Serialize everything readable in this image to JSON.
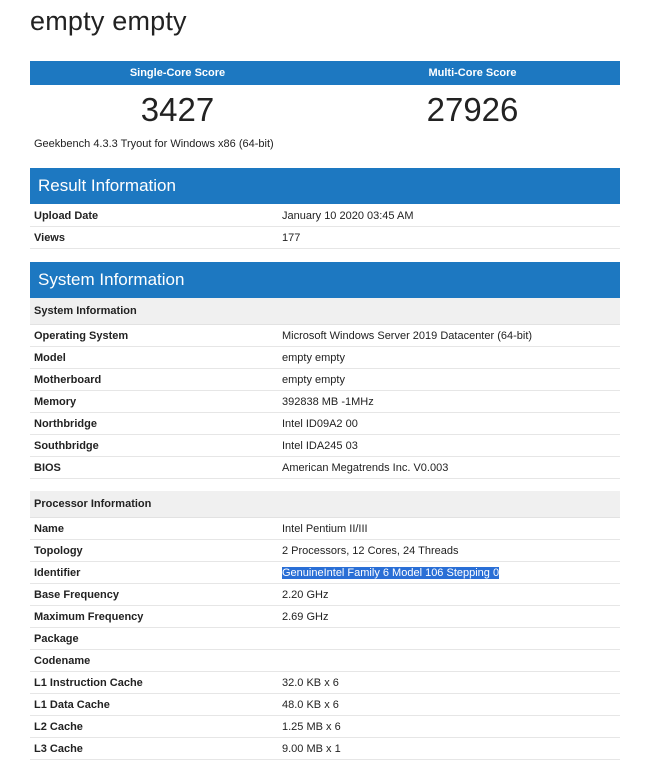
{
  "page": {
    "title": "empty empty"
  },
  "scores": {
    "single_label": "Single-Core Score",
    "multi_label": "Multi-Core Score",
    "single_value": "3427",
    "multi_value": "27926",
    "version": "Geekbench 4.3.3 Tryout for Windows x86 (64-bit)"
  },
  "result_info": {
    "title": "Result Information",
    "rows": [
      {
        "key": "Upload Date",
        "value": "January 10 2020 03:45 AM"
      },
      {
        "key": "Views",
        "value": "177"
      }
    ]
  },
  "system_info": {
    "title": "System Information",
    "system_sub": "System Information",
    "system_rows": [
      {
        "key": "Operating System",
        "value": "Microsoft Windows Server 2019 Datacenter (64-bit)"
      },
      {
        "key": "Model",
        "value": "empty empty"
      },
      {
        "key": "Motherboard",
        "value": "empty empty"
      },
      {
        "key": "Memory",
        "value": "392838 MB -1MHz"
      },
      {
        "key": "Northbridge",
        "value": "Intel ID09A2 00"
      },
      {
        "key": "Southbridge",
        "value": "Intel IDA245 03"
      },
      {
        "key": "BIOS",
        "value": "American Megatrends Inc. V0.003"
      }
    ],
    "processor_sub": "Processor Information",
    "processor_rows": [
      {
        "key": "Name",
        "value": "Intel Pentium II/III"
      },
      {
        "key": "Topology",
        "value": "2 Processors, 12 Cores, 24 Threads"
      },
      {
        "key": "Identifier",
        "value": "GenuineIntel Family 6 Model 106 Stepping 0"
      },
      {
        "key": "Base Frequency",
        "value": "2.20 GHz"
      },
      {
        "key": "Maximum Frequency",
        "value": "2.69 GHz"
      },
      {
        "key": "Package",
        "value": ""
      },
      {
        "key": "Codename",
        "value": ""
      },
      {
        "key": "L1 Instruction Cache",
        "value": "32.0 KB x 6"
      },
      {
        "key": "L1 Data Cache",
        "value": "48.0 KB x 6"
      },
      {
        "key": "L2 Cache",
        "value": "1.25 MB x 6"
      },
      {
        "key": "L3 Cache",
        "value": "9.00 MB x 1"
      }
    ]
  },
  "colors": {
    "accent": "#1d78c1",
    "selection": "#2a6fd6"
  }
}
